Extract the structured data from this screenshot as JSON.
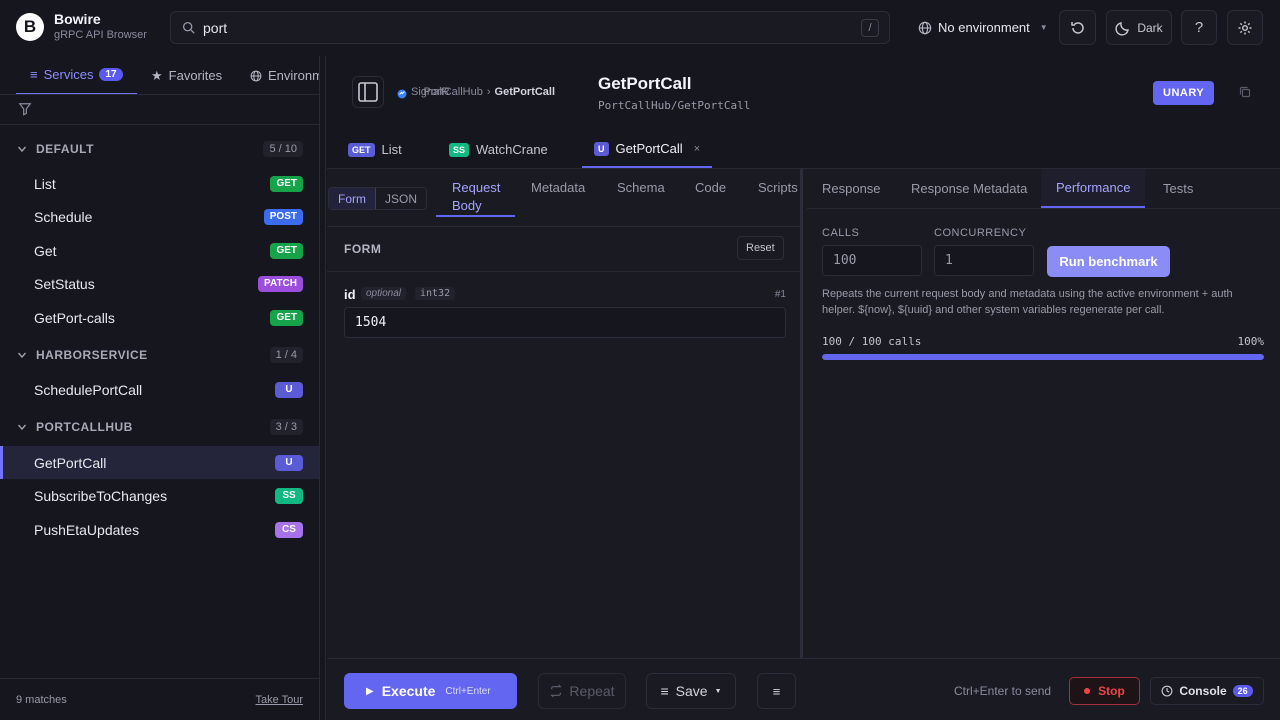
{
  "app": {
    "logo_letter": "B",
    "name": "Bowire",
    "subtitle": "gRPC API Browser"
  },
  "search": {
    "value": "port",
    "shortcut": "/"
  },
  "environment": {
    "label": "No environment"
  },
  "topbar": {
    "theme_label": "Dark",
    "help_label": "?"
  },
  "sidebar": {
    "tabs": [
      {
        "label": "Services",
        "count": "17"
      },
      {
        "label": "Favorites"
      },
      {
        "label": "Environments"
      }
    ],
    "groups": [
      {
        "name": "DEFAULT",
        "count": "5 / 10"
      },
      {
        "name": "HARBORSERVICE",
        "count": "1 / 4"
      },
      {
        "name": "PORTCALLHUB",
        "count": "3 / 3"
      }
    ],
    "items": [
      {
        "name": "List",
        "method": "GET"
      },
      {
        "name": "Schedule",
        "method": "POST"
      },
      {
        "name": "Get",
        "method": "GET"
      },
      {
        "name": "SetStatus",
        "method": "PATCH"
      },
      {
        "name": "GetPort-calls",
        "method": "GET"
      },
      {
        "name": "SchedulePortCall",
        "method": "U"
      },
      {
        "name": "GetPortCall",
        "method": "U"
      },
      {
        "name": "SubscribeToChanges",
        "method": "SS"
      },
      {
        "name": "PushEtaUpdates",
        "method": "CS"
      }
    ],
    "footer": {
      "matches": "9 matches",
      "tour": "Take Tour"
    }
  },
  "header": {
    "breadcrumb": [
      "SignalR",
      "PortCallHub",
      "GetPortCall"
    ],
    "title": "GetPortCall",
    "path": "PortCallHub/GetPortCall",
    "type_badge": "UNARY"
  },
  "request_tabs": [
    {
      "method": "GET",
      "label": "List"
    },
    {
      "method": "SS",
      "label": "WatchCrane"
    },
    {
      "method": "U",
      "label": "GetPortCall",
      "close": "×"
    }
  ],
  "request": {
    "mode_toggle": [
      "Form",
      "JSON"
    ],
    "tabs": [
      "Request Body",
      "Metadata",
      "Schema",
      "Code",
      "Scripts"
    ],
    "form_label": "FORM",
    "reset_label": "Reset",
    "field": {
      "name": "id",
      "optional": "optional",
      "type": "int32",
      "number": "#1",
      "value": "1504"
    }
  },
  "response": {
    "tabs": [
      "Response",
      "Response Metadata",
      "Performance",
      "Tests"
    ],
    "calls_label": "CALLS",
    "calls_placeholder": "100",
    "concurrency_label": "CONCURRENCY",
    "concurrency_placeholder": "1",
    "run_label": "Run benchmark",
    "description": "Repeats the current request body and metadata using the active environment + auth helper. ${now}, ${uuid} and other system variables regenerate per call.",
    "progress_label": "100 / 100 calls",
    "progress_pct": "100%",
    "progress_fraction": 1.0
  },
  "bottom": {
    "execute": "Execute",
    "execute_shortcut": "Ctrl+Enter",
    "repeat": "Repeat",
    "save": "Save",
    "hint": "Ctrl+Enter to send",
    "stop": "Stop",
    "console": "Console",
    "console_count": "26"
  }
}
